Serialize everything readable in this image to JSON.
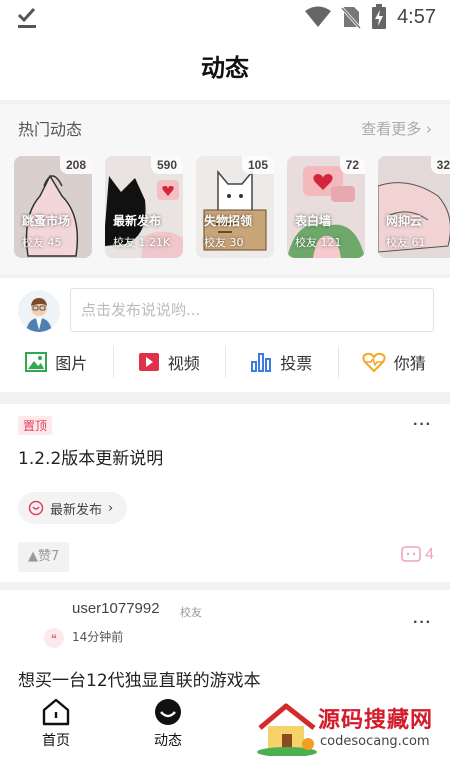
{
  "status_bar": {
    "time": "4:57"
  },
  "title": "动态",
  "hot": {
    "heading": "热门动态",
    "more": "查看更多",
    "cards": [
      {
        "count": "208",
        "name": "跳蚤市场",
        "fans": "校友 45"
      },
      {
        "count": "590",
        "name": "最新发布",
        "fans": "校友 1.21K"
      },
      {
        "count": "105",
        "name": "失物招领",
        "fans": "校友 30"
      },
      {
        "count": "72",
        "name": "表白墙",
        "fans": "校友 121"
      },
      {
        "count": "32",
        "name": "网抑云",
        "fans": "校友 61"
      }
    ]
  },
  "composer": {
    "placeholder": "点击发布说说哟...",
    "actions": [
      {
        "label": "图片",
        "icon": "image-icon",
        "color": "#2fa84f"
      },
      {
        "label": "视频",
        "icon": "video-icon",
        "color": "#e0304a"
      },
      {
        "label": "投票",
        "icon": "vote-chart-icon",
        "color": "#3d7be0"
      },
      {
        "label": "你猜",
        "icon": "heart-pulse-icon",
        "color": "#f5a623"
      }
    ]
  },
  "pinned_post": {
    "tag": "置顶",
    "title": "1.2.2版本更新说明",
    "chip": "最新发布",
    "likes": "赞7",
    "comments": "4"
  },
  "feed_post": {
    "user": "user1077992",
    "role": "校友",
    "time": "14分钟前",
    "body": "想买一台12代独显直联的游戏本"
  },
  "tabbar": {
    "tabs": [
      {
        "label": "首页"
      },
      {
        "label": "动态"
      }
    ]
  },
  "watermark": {
    "text": "源码搜藏网",
    "url": "codesocang.com"
  }
}
